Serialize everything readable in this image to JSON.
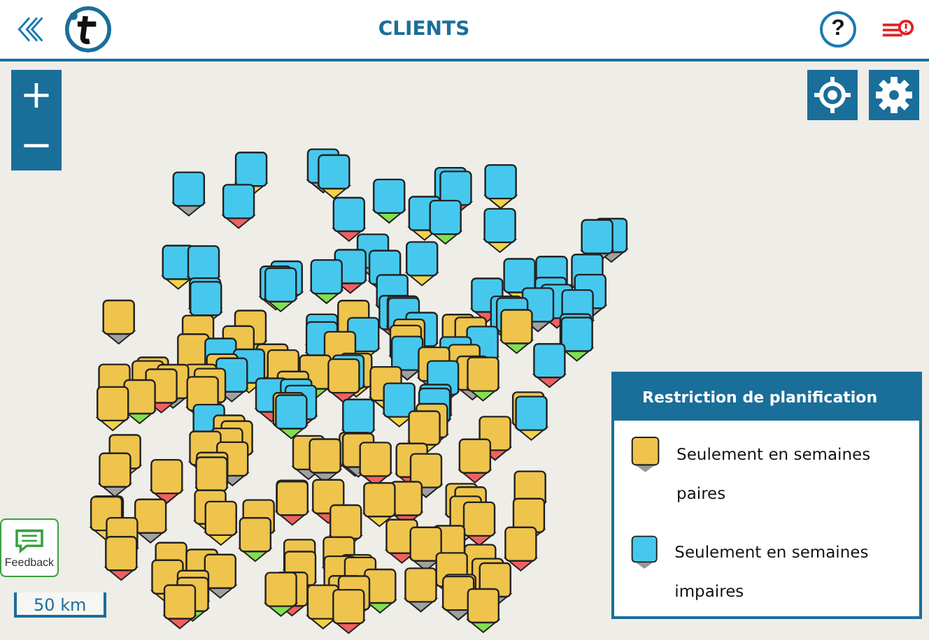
{
  "header": {
    "title": "CLIENTS",
    "help": "?"
  },
  "map": {
    "zoom_in": "+",
    "zoom_out": "−",
    "scale": "50 km",
    "feedback": "Feedback"
  },
  "legend": {
    "title": "Restriction de planification",
    "items": [
      {
        "label": "Seulement en semaines paires",
        "color": "#efc44c"
      },
      {
        "label": "Seulement en semaines impaires",
        "color": "#46c8ee"
      }
    ]
  }
}
